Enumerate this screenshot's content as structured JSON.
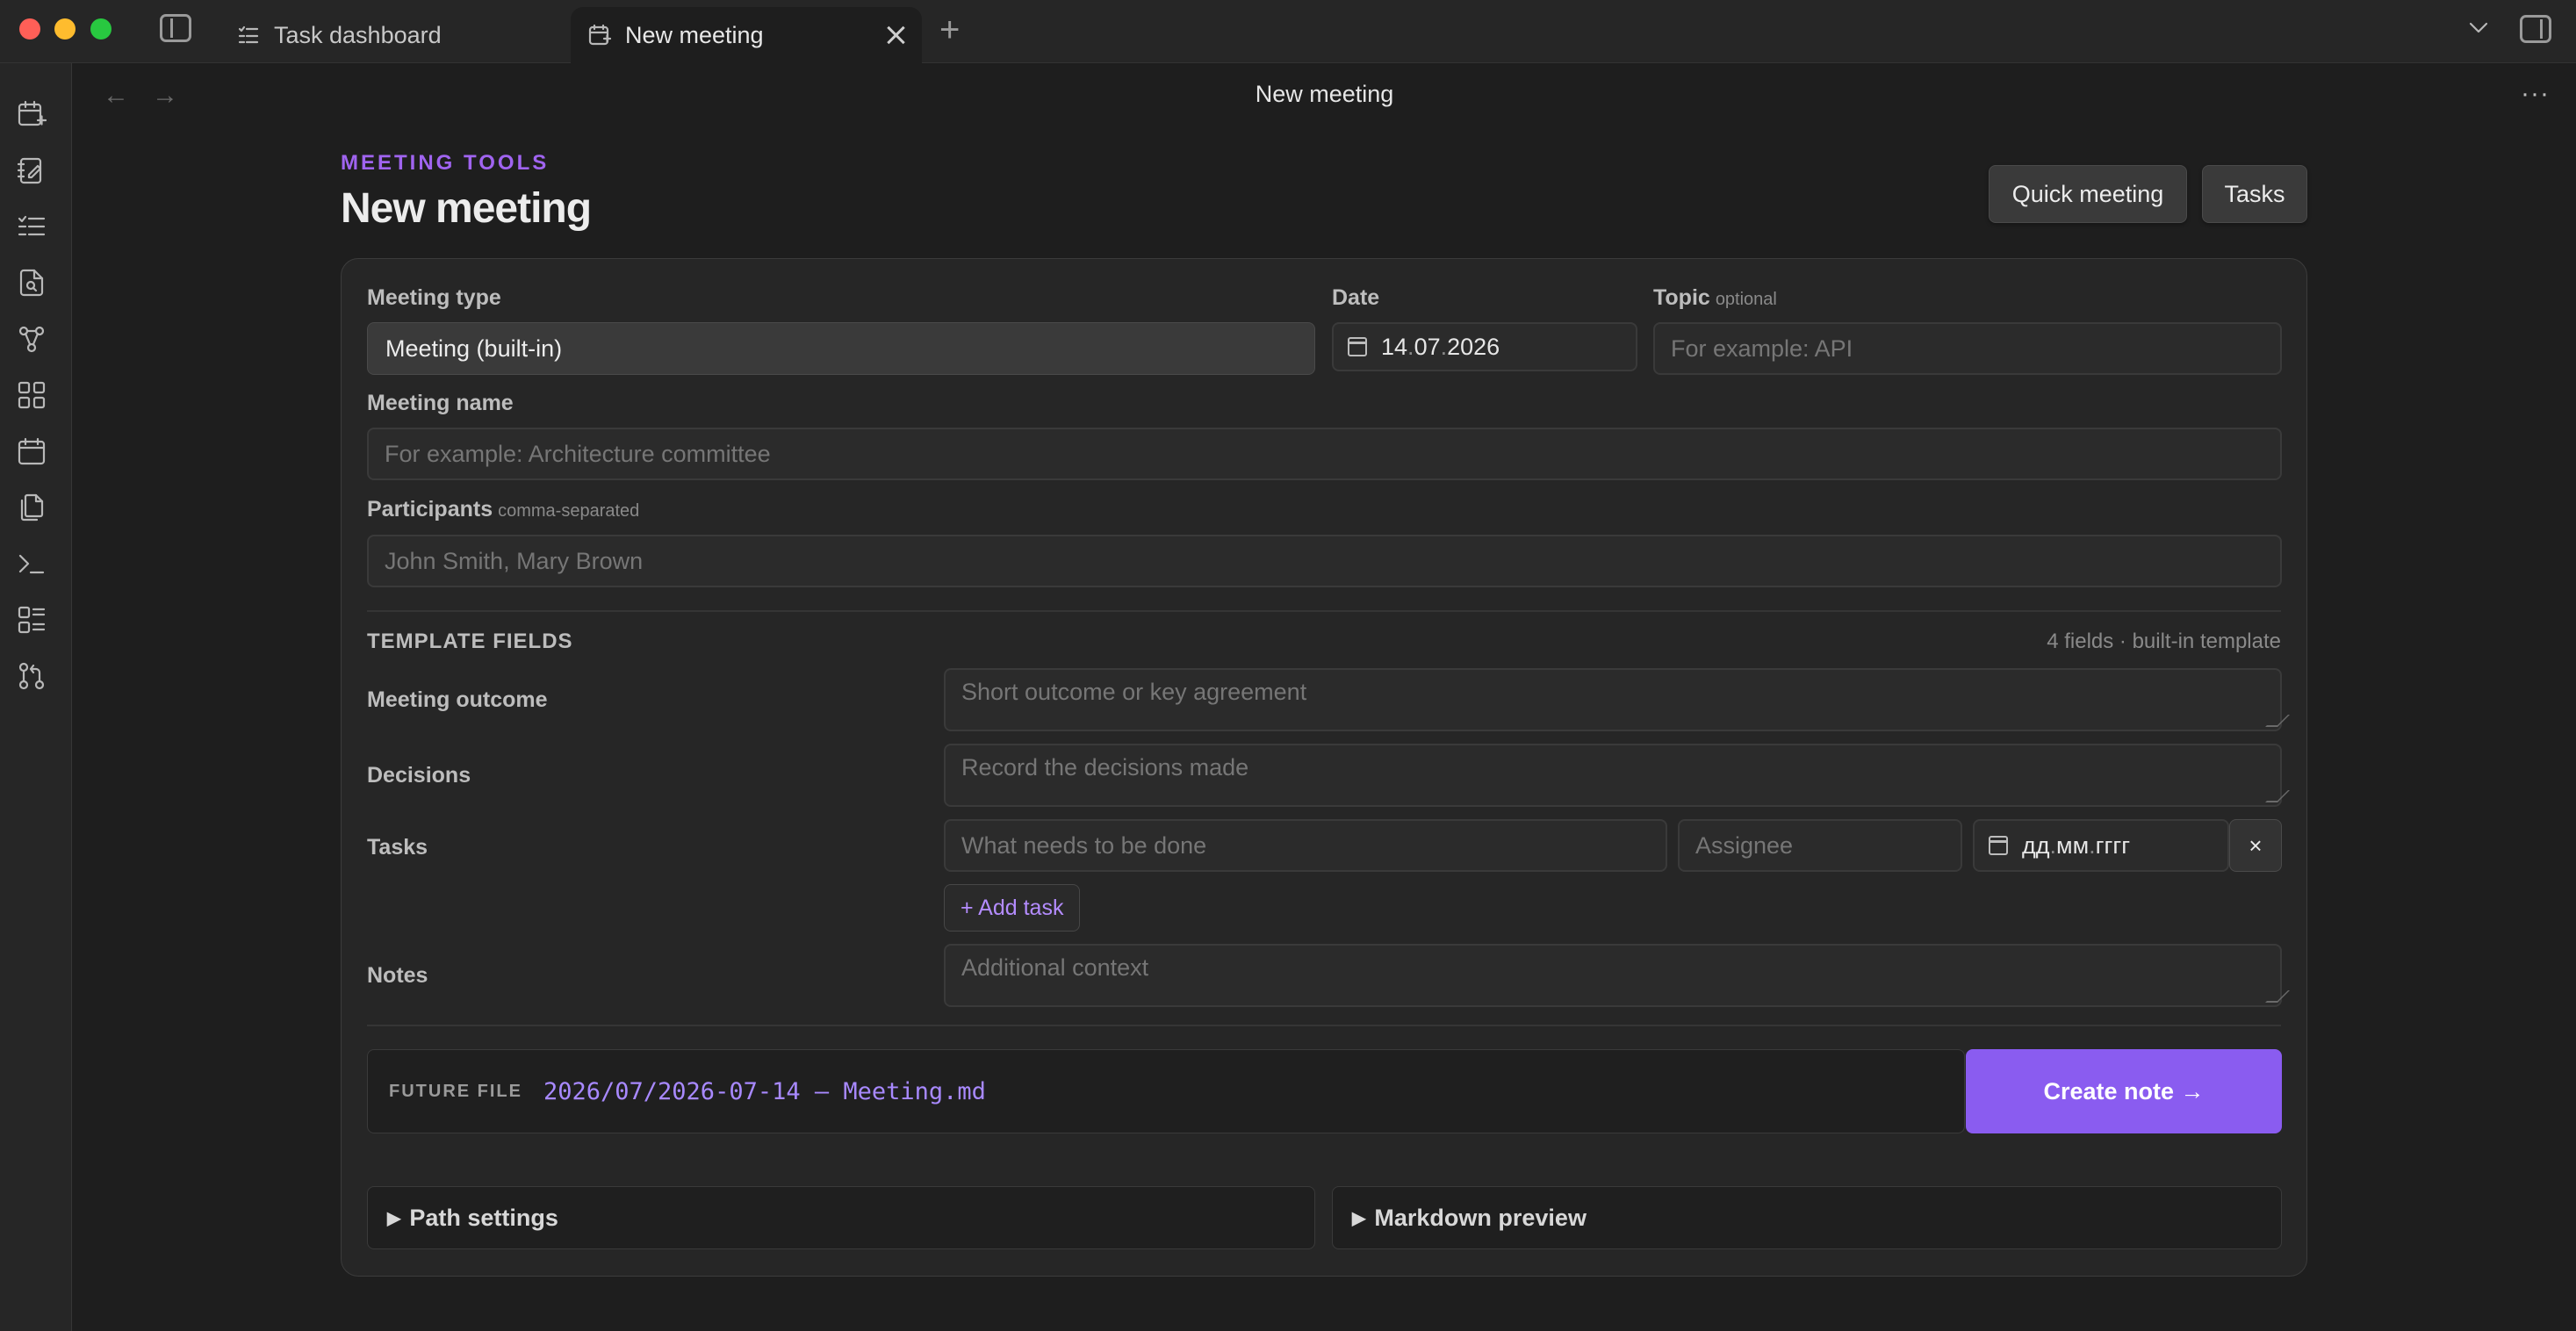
{
  "tabs": [
    {
      "label": "Task dashboard",
      "active": false
    },
    {
      "label": "New meeting",
      "active": true
    }
  ],
  "nav": {
    "title": "New meeting"
  },
  "header": {
    "kicker": "MEETING TOOLS",
    "title": "New meeting",
    "quick_meeting": "Quick meeting",
    "tasks": "Tasks"
  },
  "form": {
    "meeting_type": {
      "label": "Meeting type",
      "value": "Meeting (built-in)"
    },
    "date": {
      "label": "Date",
      "d": "14",
      "m": "07",
      "y": "2026"
    },
    "topic": {
      "label": "Topic",
      "hint": "optional",
      "placeholder": "For example: API"
    },
    "meeting_name": {
      "label": "Meeting name",
      "placeholder": "For example: Architecture committee"
    },
    "participants": {
      "label": "Participants",
      "hint": "comma-separated",
      "placeholder": "John Smith, Mary Brown"
    }
  },
  "template": {
    "heading": "TEMPLATE FIELDS",
    "meta": "4 fields · built-in template",
    "outcome": {
      "label": "Meeting outcome",
      "placeholder": "Short outcome or key agreement"
    },
    "decisions": {
      "label": "Decisions",
      "placeholder": "Record the decisions made"
    },
    "tasks": {
      "label": "Tasks",
      "what_placeholder": "What needs to be done",
      "assignee_placeholder": "Assignee",
      "date_d": "дд",
      "date_m": "мм",
      "date_y": "гггг",
      "remove": "×",
      "add": "+ Add task"
    },
    "notes": {
      "label": "Notes",
      "placeholder": "Additional context"
    }
  },
  "future_file": {
    "label": "FUTURE FILE",
    "path": "2026/07/2026-07-14 — Meeting.md"
  },
  "create_button": "Create note →",
  "sections": {
    "path_settings": "Path settings",
    "markdown_preview": "Markdown preview"
  },
  "colors": {
    "accent": "#8a5cf0",
    "kicker": "#a064f0",
    "background": "#1e1e1e"
  }
}
